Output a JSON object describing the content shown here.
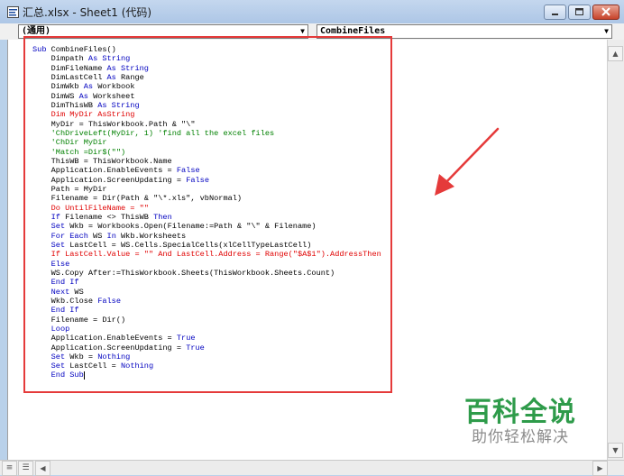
{
  "window": {
    "title": "汇总.xlsx - Sheet1 (代码)",
    "buttons": [
      "minimize",
      "maximize",
      "close"
    ]
  },
  "toolbar": {
    "object_combo": "(通用)",
    "procedure_combo": "CombineFiles"
  },
  "code_lines": [
    {
      "segments": [
        {
          "t": "Sub ",
          "c": "kw"
        },
        {
          "t": "CombineFiles()"
        }
      ]
    },
    {
      "segments": [
        {
          "t": "    Dim"
        },
        {
          "t": "path "
        },
        {
          "t": "As String",
          "c": "kw"
        }
      ]
    },
    {
      "segments": [
        {
          "t": "    DimFileName "
        },
        {
          "t": "As String",
          "c": "kw"
        }
      ]
    },
    {
      "segments": [
        {
          "t": "    DimLastCell "
        },
        {
          "t": "As ",
          "c": "kw"
        },
        {
          "t": "Range"
        }
      ]
    },
    {
      "segments": [
        {
          "t": "    DimWkb "
        },
        {
          "t": "As ",
          "c": "kw"
        },
        {
          "t": "Workbook"
        }
      ]
    },
    {
      "segments": [
        {
          "t": "    DimWS "
        },
        {
          "t": "As ",
          "c": "kw"
        },
        {
          "t": "Worksheet"
        }
      ]
    },
    {
      "segments": [
        {
          "t": "    DimThisWB "
        },
        {
          "t": "As String",
          "c": "kw"
        }
      ]
    },
    {
      "segments": [
        {
          "t": "    Dim MyDir AsString",
          "c": "err"
        }
      ]
    },
    {
      "segments": [
        {
          "t": "    MyDir = ThisWorkbook.Path & \"\\\""
        }
      ]
    },
    {
      "segments": [
        {
          "t": "    'ChDriveLeft(MyDir, 1) 'find all the excel files",
          "c": "cm"
        }
      ]
    },
    {
      "segments": [
        {
          "t": "    'ChDir MyDir",
          "c": "cm"
        }
      ]
    },
    {
      "segments": [
        {
          "t": "    'Match =Dir$(\"\")",
          "c": "cm"
        }
      ]
    },
    {
      "segments": [
        {
          "t": "    ThisWB = ThisWorkbook.Name"
        }
      ]
    },
    {
      "segments": [
        {
          "t": "    Application.EnableEvents = "
        },
        {
          "t": "False",
          "c": "kw"
        }
      ]
    },
    {
      "segments": [
        {
          "t": "    Application.ScreenUpdating = "
        },
        {
          "t": "False",
          "c": "kw"
        }
      ]
    },
    {
      "segments": [
        {
          "t": "    Path = MyDir"
        }
      ]
    },
    {
      "segments": [
        {
          "t": "    Filename = Dir(Path & \"\\*.xls\", vbNormal)"
        }
      ]
    },
    {
      "segments": [
        {
          "t": "    Do UntilFileName = \"\"",
          "c": "err"
        }
      ]
    },
    {
      "segments": [
        {
          "t": "    If ",
          "c": "kw"
        },
        {
          "t": "Filename <> ThisWB "
        },
        {
          "t": "Then",
          "c": "kw"
        }
      ]
    },
    {
      "segments": [
        {
          "t": "    Set ",
          "c": "kw"
        },
        {
          "t": "Wkb = Workbooks.Open(Filename:=Path & \"\\\" & Filename)"
        }
      ]
    },
    {
      "segments": [
        {
          "t": "    For Each ",
          "c": "kw"
        },
        {
          "t": "WS "
        },
        {
          "t": "In ",
          "c": "kw"
        },
        {
          "t": "Wkb.Worksheets"
        }
      ]
    },
    {
      "segments": [
        {
          "t": "    Set ",
          "c": "kw"
        },
        {
          "t": "LastCell = WS.Cells.SpecialCells(xlCellTypeLastCell)"
        }
      ]
    },
    {
      "segments": [
        {
          "t": "    If LastCell.Value = \"\" And LastCell.Address = Range(\"$A$1\").AddressThen",
          "c": "err"
        }
      ]
    },
    {
      "segments": [
        {
          "t": "    Else",
          "c": "kw"
        }
      ]
    },
    {
      "segments": [
        {
          "t": "    WS.Copy After:=ThisWorkbook.Sheets(ThisWorkbook.Sheets.Count)"
        }
      ]
    },
    {
      "segments": [
        {
          "t": "    End If",
          "c": "kw"
        }
      ]
    },
    {
      "segments": [
        {
          "t": "    Next ",
          "c": "kw"
        },
        {
          "t": "WS"
        }
      ]
    },
    {
      "segments": [
        {
          "t": "    Wkb.Close "
        },
        {
          "t": "False",
          "c": "kw"
        }
      ]
    },
    {
      "segments": [
        {
          "t": "    End If",
          "c": "kw"
        }
      ]
    },
    {
      "segments": [
        {
          "t": "    Filename = Dir()"
        }
      ]
    },
    {
      "segments": [
        {
          "t": "    Loop",
          "c": "kw"
        }
      ]
    },
    {
      "segments": [
        {
          "t": "    Application.EnableEvents = "
        },
        {
          "t": "True",
          "c": "kw"
        }
      ]
    },
    {
      "segments": [
        {
          "t": "    Application.ScreenUpdating = "
        },
        {
          "t": "True",
          "c": "kw"
        }
      ]
    },
    {
      "segments": [
        {
          "t": "    Set ",
          "c": "kw"
        },
        {
          "t": "Wkb = "
        },
        {
          "t": "Nothing",
          "c": "kw"
        }
      ]
    },
    {
      "segments": [
        {
          "t": "    Set ",
          "c": "kw"
        },
        {
          "t": "LastCell = "
        },
        {
          "t": "Nothing",
          "c": "kw"
        }
      ]
    },
    {
      "segments": [
        {
          "t": "    End Sub",
          "c": "kw"
        }
      ],
      "cursor": true
    }
  ],
  "watermark": {
    "main": "百科全说",
    "sub": "助你轻松解决"
  },
  "colors": {
    "keyword": "#0000c0",
    "error": "#e00000",
    "comment": "#008000",
    "highlight_box": "#e53a3a",
    "watermark_green": "#2e9b4a"
  }
}
